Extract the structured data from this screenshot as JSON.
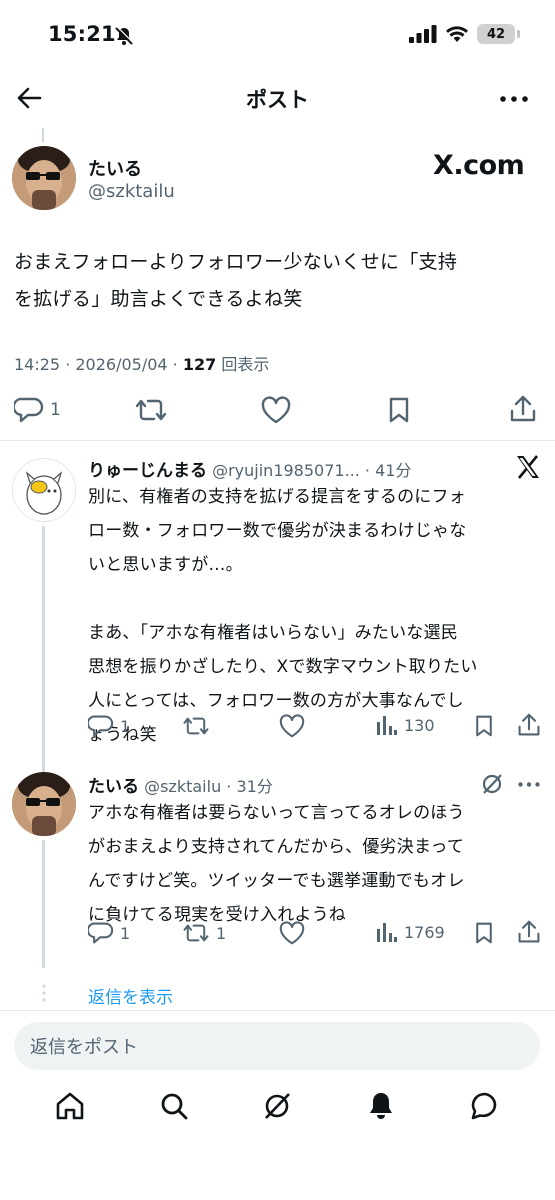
{
  "status_bar": {
    "time": "15:21",
    "battery": "42"
  },
  "header": {
    "title": "ポスト"
  },
  "post": {
    "name": "たいる",
    "handle": "@szktailu",
    "badge": "X.com",
    "text_line1": "おまえフォローよりフォロワー少ないくせに「支持",
    "text_line2": "を拡げる」助言よくできるよね笑",
    "meta_time": "14:25 · 2026/05/04 · ",
    "views_count": "127",
    "views_label": "回表示",
    "reply_count": "1"
  },
  "reply1": {
    "name": "りゅーじんまる",
    "handle": "@ryujin1985071...",
    "time": "· 41分",
    "lines": [
      "別に、有権者の支持を拡げる提言をするのにフォ",
      "ロー数・フォロワー数で優劣が決まるわけじゃな",
      "いと思いますが…。",
      "",
      "まあ、「アホな有権者はいらない」みたいな選民",
      "思想を振りかざしたり、Xで数字マウント取りたい",
      "人にとっては、フォロワー数の方が大事なんでし",
      "ょうね笑"
    ],
    "reply_count": "1",
    "views": "130"
  },
  "reply2": {
    "name": "たいる",
    "handle": "@szktailu",
    "time": "· 31分",
    "lines": [
      "アホな有権者は要らないって言ってるオレのほう",
      "がおまえより支持されてんだから、優劣決まって",
      "んですけど笑。ツイッターでも選挙運動でもオレ",
      "に負けてる現実を受け入れようね"
    ],
    "reply_count": "1",
    "repost_count": "1",
    "views": "1769"
  },
  "show_replies": "返信を表示",
  "reply_input": {
    "placeholder": "返信をポスト"
  }
}
